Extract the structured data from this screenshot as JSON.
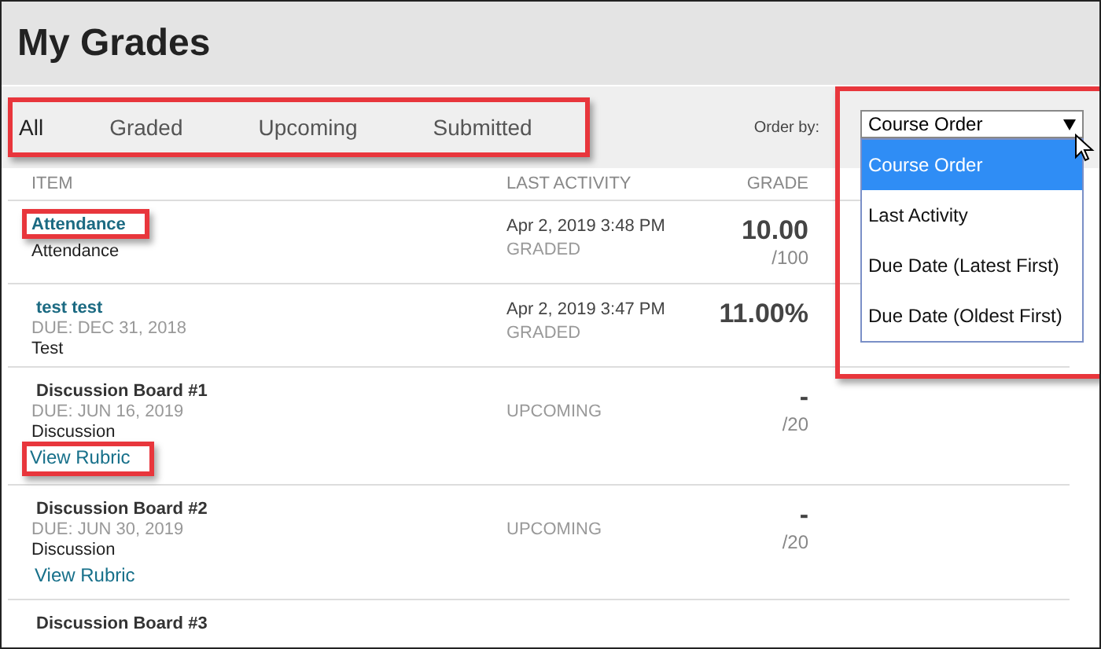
{
  "page": {
    "title": "My Grades"
  },
  "filter_tabs": {
    "highlighted": true,
    "tabs": [
      {
        "label": "All",
        "selected": true
      },
      {
        "label": "Graded",
        "selected": false
      },
      {
        "label": "Upcoming",
        "selected": false
      },
      {
        "label": "Submitted",
        "selected": false
      }
    ]
  },
  "order_by": {
    "label": "Order by:",
    "value": "Course Order",
    "expanded": true,
    "highlighted": true,
    "options": [
      {
        "label": "Course Order",
        "selected": true
      },
      {
        "label": "Last Activity",
        "selected": false
      },
      {
        "label": "Due Date (Latest First)",
        "selected": false
      },
      {
        "label": "Due Date (Oldest First)",
        "selected": false
      }
    ]
  },
  "table": {
    "columns": [
      "ITEM",
      "LAST ACTIVITY",
      "GRADE"
    ],
    "rows": [
      {
        "title": "Attendance",
        "linked": true,
        "highlighted": true,
        "category": "Attendance",
        "activity": "Apr 2, 2019 3:48 PM",
        "status": "GRADED",
        "grade": "10.00",
        "out_of": "/100"
      },
      {
        "title": "test test",
        "linked": true,
        "highlighted": false,
        "due": "DUE: DEC 31, 2018",
        "category": "Test",
        "activity": "Apr 2, 2019 3:47 PM",
        "status": "GRADED",
        "grade": "11.00%"
      },
      {
        "title": "Discussion Board #1",
        "linked": false,
        "highlighted": false,
        "due": "DUE: JUN 16, 2019",
        "category": "Discussion",
        "rubric": {
          "label": "View Rubric",
          "highlighted": true
        },
        "status": "UPCOMING",
        "grade": "-",
        "out_of": "/20"
      },
      {
        "title": "Discussion Board #2",
        "linked": false,
        "highlighted": false,
        "due": "DUE: JUN 30, 2019",
        "category": "Discussion",
        "rubric": {
          "label": "View Rubric",
          "highlighted": false
        },
        "status": "UPCOMING",
        "grade": "-",
        "out_of": "/20"
      },
      {
        "title": "Discussion Board #3"
      }
    ]
  }
}
